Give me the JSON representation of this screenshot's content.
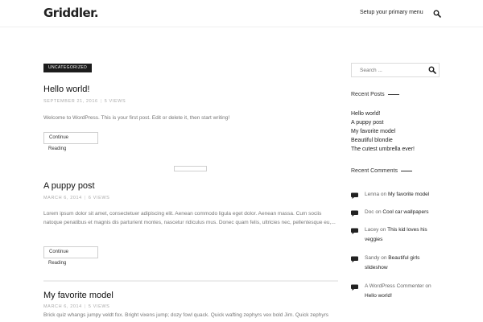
{
  "site": {
    "logo": "Griddler.",
    "menu_link": "Setup your primary menu"
  },
  "posts": [
    {
      "category": "UNCATEGORIZED",
      "title": "Hello world!",
      "date": "SEPTEMBER 21, 2016",
      "views": "5 VIEWS",
      "excerpt": "Welcome to WordPress. This is your first post. Edit or delete it, then start writing!",
      "button_line1": "Continue",
      "button_line2": "Reading"
    },
    {
      "title": "A puppy post",
      "date": "MARCH 6, 2014",
      "views": "6 VIEWS",
      "excerpt": "Lorem ipsum dolor sit amet, consectetuer adipiscing elit. Aenean commodo ligula eget dolor. Aenean massa. Cum sociis natoque penatibus et magnis dis parturient montes, nascetur ridiculus mus. Donec quam felis, ultricies nec, pellentesque eu,...",
      "button_line1": "Continue",
      "button_line2": "Reading"
    },
    {
      "title": "My favorite model",
      "date": "MARCH 6, 2014",
      "views": "5 VIEWS",
      "excerpt": "Brick quiz whangs jumpy veldt fox. Bright vixens jump; dozy fowl quack. Quick wafting zephyrs vex bold Jim. Quick zephyrs"
    }
  ],
  "sidebar": {
    "search_placeholder": "Search ...",
    "recent_posts_title": "Recent Posts",
    "recent_posts": [
      "Hello world!",
      "A puppy post",
      "My favorite model",
      "Beautiful blondie",
      "The cutest umbrella ever!"
    ],
    "recent_comments_title": "Recent Comments",
    "on_word": "on",
    "comments": [
      {
        "author": "Lenna",
        "post": "My favorite model"
      },
      {
        "author": "Doc",
        "post": "Cool car wallpapers"
      },
      {
        "author": "Lacey",
        "post": "This kid loves his veggies"
      },
      {
        "author": "Sandy",
        "post": "Beautiful girls slideshow"
      },
      {
        "author": "A WordPress Commenter",
        "post": "Hello world!"
      }
    ]
  },
  "icons": {
    "search": "search-icon",
    "comment": "comment-bubble-icon"
  },
  "colors": {
    "badge_bg": "#1c1c1c",
    "text_dark": "#222222",
    "meta": "#aaaaaa"
  }
}
